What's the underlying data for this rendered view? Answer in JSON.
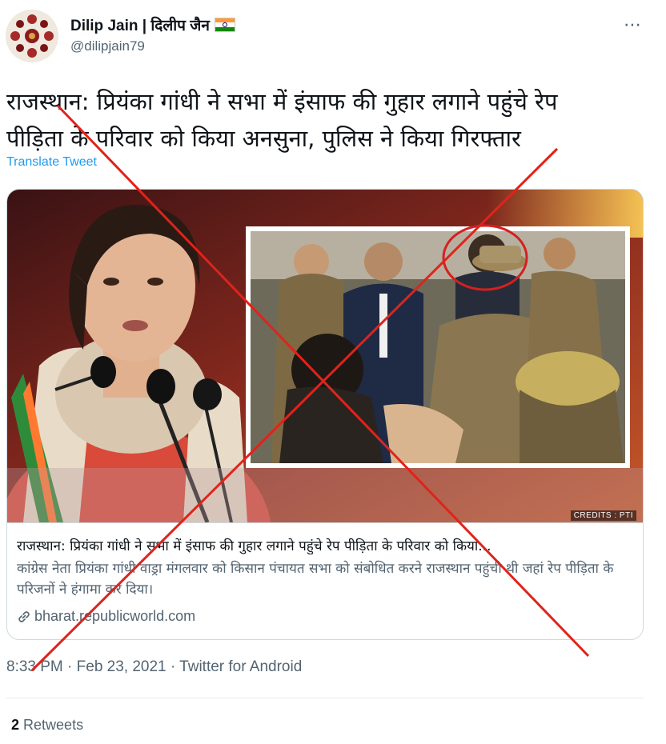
{
  "author": {
    "display_name": "Dilip Jain | दिलीप जैन",
    "handle": "@dilipjain79",
    "avatar_icon": "avatar-rose-pattern",
    "flag_icon": "india-flag-icon"
  },
  "more_icon": "⋯",
  "tweet": {
    "text_line1": "राजस्थान: प्रियंका गांधी ने सभा में इंसाफ की गुहार लगाने पहुंचे रेप",
    "text_line2": "पीड़िता के परिवार को किया अनसुना, पुलिस ने किया गिरफ्तार",
    "translate_label": "Translate Tweet"
  },
  "card": {
    "image_credit": "CREDITS : PTI",
    "title": "राजस्थान: प्रियंका गांधी ने सभा में इंसाफ की गुहार लगाने पहुंचे रेप पीड़िता के परिवार को किया...",
    "description": "कांग्रेस नेता प्रियंका गांधी वाड्रा मंगलवार को किसान पंचायत सभा को संबोधित करने राजस्थान पहुंची थी जहां रेप पीड़िता के परिजनों ने हंगामा कर दिया।",
    "domain": "bharat.republicworld.com"
  },
  "meta": {
    "timestamp": "8:33 PM · Feb 23, 2021 · Twitter for Android"
  },
  "stats": {
    "retweet_count": "2",
    "retweet_label": "Retweets"
  },
  "colors": {
    "link": "#1d9bf0",
    "secondary_text": "#536471",
    "cross_red": "#e0231b",
    "border": "#cfd9de"
  }
}
